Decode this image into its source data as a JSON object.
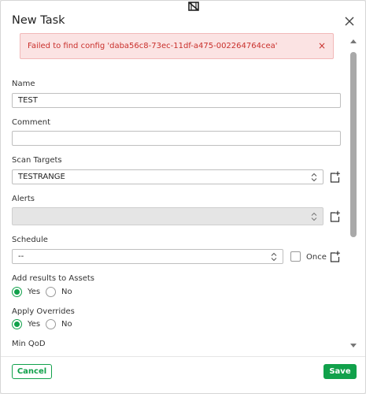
{
  "dialog": {
    "title": "New Task",
    "error_message": "Failed to find config 'daba56c8-73ec-11df-a475-002264764cea'",
    "error_close": "×"
  },
  "form": {
    "name": {
      "label": "Name",
      "value": "TEST"
    },
    "comment": {
      "label": "Comment",
      "value": ""
    },
    "scan_targets": {
      "label": "Scan Targets",
      "value": "TESTRANGE"
    },
    "alerts": {
      "label": "Alerts",
      "value": ""
    },
    "schedule": {
      "label": "Schedule",
      "value": "--",
      "once_label": "Once"
    },
    "add_results_to_assets": {
      "label": "Add results to Assets",
      "yes": "Yes",
      "no": "No",
      "selected": "Yes"
    },
    "apply_overrides": {
      "label": "Apply Overrides",
      "yes": "Yes",
      "no": "No",
      "selected": "Yes"
    },
    "min_qod": {
      "label": "Min QoD"
    }
  },
  "footer": {
    "cancel_label": "Cancel",
    "save_label": "Save"
  },
  "colors": {
    "accent": "#11a14b",
    "error_text": "#c9302c",
    "error_bg": "#fbe3e3"
  },
  "icons": [
    "new-task-top-icon",
    "close-icon",
    "select-arrows-icon",
    "new-item-icon"
  ]
}
